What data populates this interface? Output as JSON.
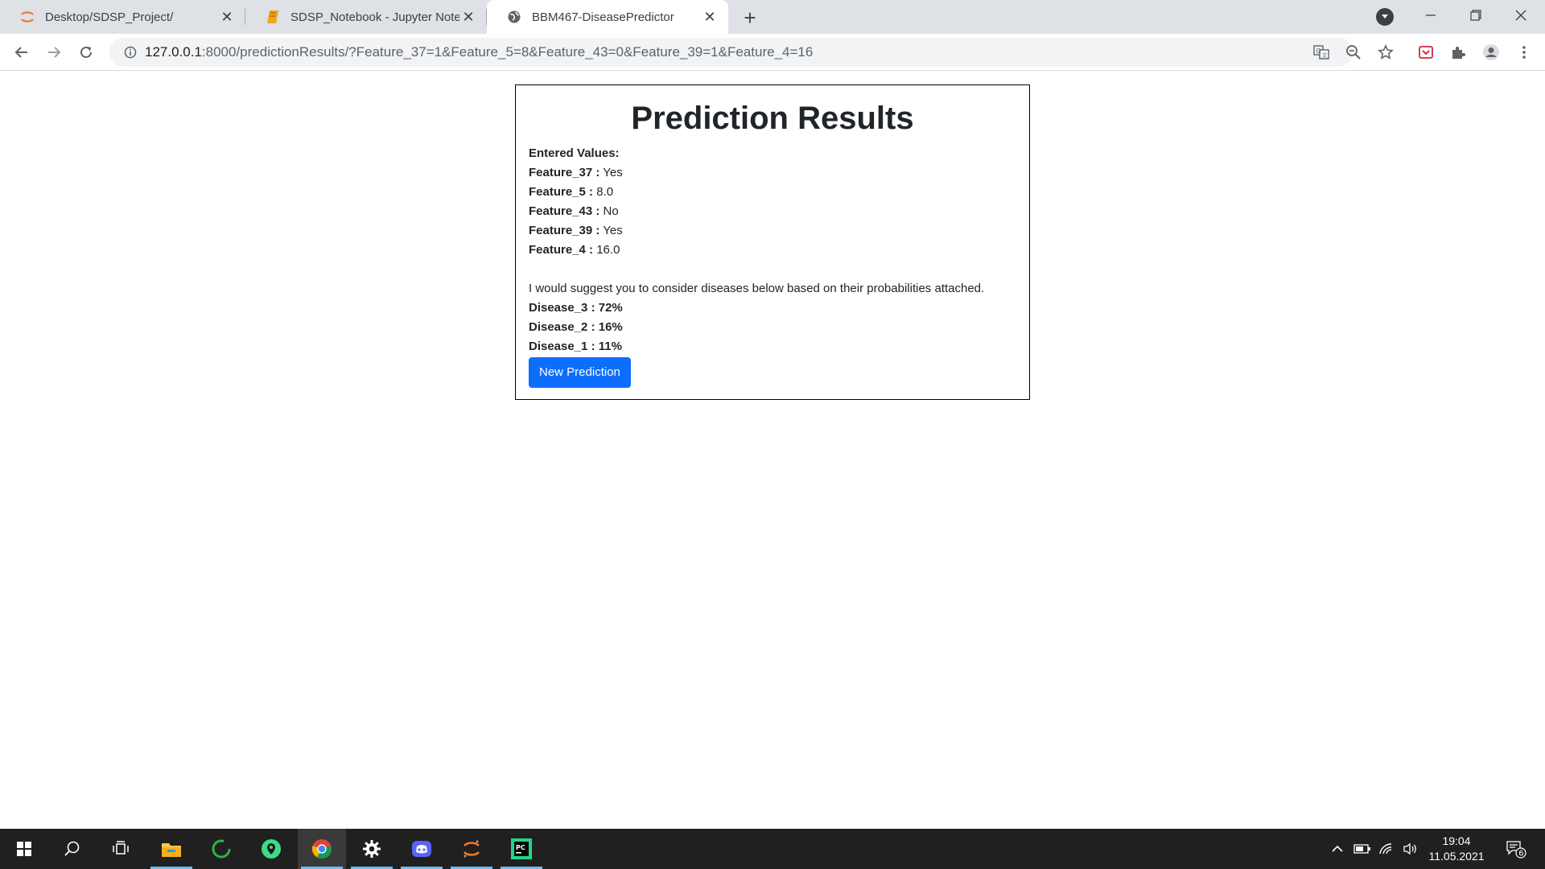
{
  "browser": {
    "tabs": [
      {
        "title": "Desktop/SDSP_Project/",
        "icon": "jupyter-icon"
      },
      {
        "title": "SDSP_Notebook - Jupyter Notebook",
        "icon": "notebook-icon"
      },
      {
        "title": "BBM467-DiseasePredictor",
        "icon": "globe-icon"
      }
    ],
    "url_host": "127.0.0.1",
    "url_rest": ":8000/predictionResults/?Feature_37=1&Feature_5=8&Feature_43=0&Feature_39=1&Feature_4=16"
  },
  "page": {
    "title": "Prediction Results",
    "entered_label": "Entered Values:",
    "features": [
      {
        "name": "Feature_37 :",
        "value": "Yes"
      },
      {
        "name": "Feature_5 :",
        "value": "8.0"
      },
      {
        "name": "Feature_43 :",
        "value": "No"
      },
      {
        "name": "Feature_39 :",
        "value": "Yes"
      },
      {
        "name": "Feature_4 :",
        "value": "16.0"
      }
    ],
    "suggestion": "I would suggest you to consider diseases below based on their probabilities attached.",
    "diseases": [
      {
        "name": "Disease_3 :",
        "prob": "72%"
      },
      {
        "name": "Disease_2 :",
        "prob": "16%"
      },
      {
        "name": "Disease_1 :",
        "prob": "11%"
      }
    ],
    "new_prediction_label": "New Prediction"
  },
  "taskbar": {
    "time": "19:04",
    "date": "11.05.2021",
    "notification_count": "6"
  },
  "colors": {
    "primary_button": "#0d6efd",
    "taskbar": "#202020",
    "tabstrip": "#dee1e6"
  }
}
